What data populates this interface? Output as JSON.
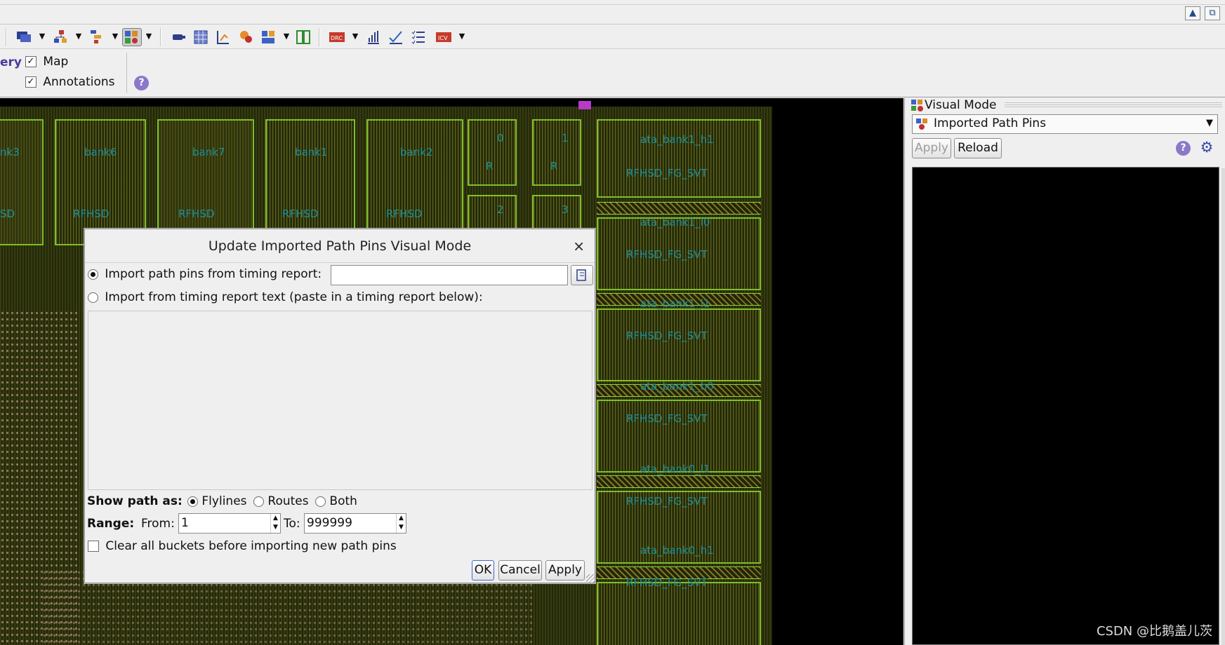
{
  "toolbar": {
    "icons": [
      "comment-icon",
      "hierarchy-icon",
      "tree-icon",
      "visual-mode-icon",
      "plug-icon",
      "grid-icon",
      "route-icon",
      "pin-icon",
      "layout-icon",
      "compare-icon",
      "drc-icon",
      "chart-icon",
      "check-icon",
      "list-icon",
      "icv-icon"
    ]
  },
  "options": {
    "left_truncated_label": "ery",
    "map_label": "Map",
    "annotations_label": "Annotations",
    "map_checked": true,
    "annotations_checked": true
  },
  "canvas": {
    "labels_top": [
      "nk3",
      "bank6",
      "bank7",
      "bank1",
      "bank2"
    ],
    "labels_rfhsd": [
      "SD",
      "RFHSD",
      "RFHSD",
      "RFHSD",
      "RFHSD"
    ],
    "small_labels": [
      "0",
      "1",
      "R",
      "R",
      "2",
      "3"
    ],
    "right_labels": [
      "ata_bank1_h1",
      "RFHSD_FG_SVT",
      "ata_bank1_l0",
      "RFHSD_FG_SVT",
      "ata_bank1_l1",
      "RFHSD_FG_SVT",
      "ata_bank1_h0",
      "RFHSD_FG_SVT",
      "ata_bank0_l1",
      "RFHSD_FG_SVT",
      "ata_bank0_h1",
      "RFHSD_FG_SVT"
    ]
  },
  "right_panel": {
    "title": "Visual Mode",
    "mode_selected": "Imported Path Pins",
    "apply_label": "Apply",
    "reload_label": "Reload"
  },
  "dialog": {
    "title": "Update Imported Path Pins Visual Mode",
    "close_glyph": "×",
    "option_report": "Import path pins from timing report:",
    "option_report_selected": true,
    "report_path_value": "",
    "option_text": "Import from timing report text (paste in a timing report below):",
    "report_text_value": "",
    "show_path_label": "Show path as:",
    "show_flylines": "Flylines",
    "show_routes": "Routes",
    "show_both": "Both",
    "show_selected": "Flylines",
    "range_label": "Range:",
    "from_label": "From:",
    "from_value": "1",
    "to_label": "To:",
    "to_value": "999999",
    "clear_label": "Clear all buckets before importing new path pins",
    "clear_checked": false,
    "ok_label": "OK",
    "cancel_label": "Cancel",
    "apply_label": "Apply"
  },
  "watermark": "CSDN @比鹅盖儿茨"
}
